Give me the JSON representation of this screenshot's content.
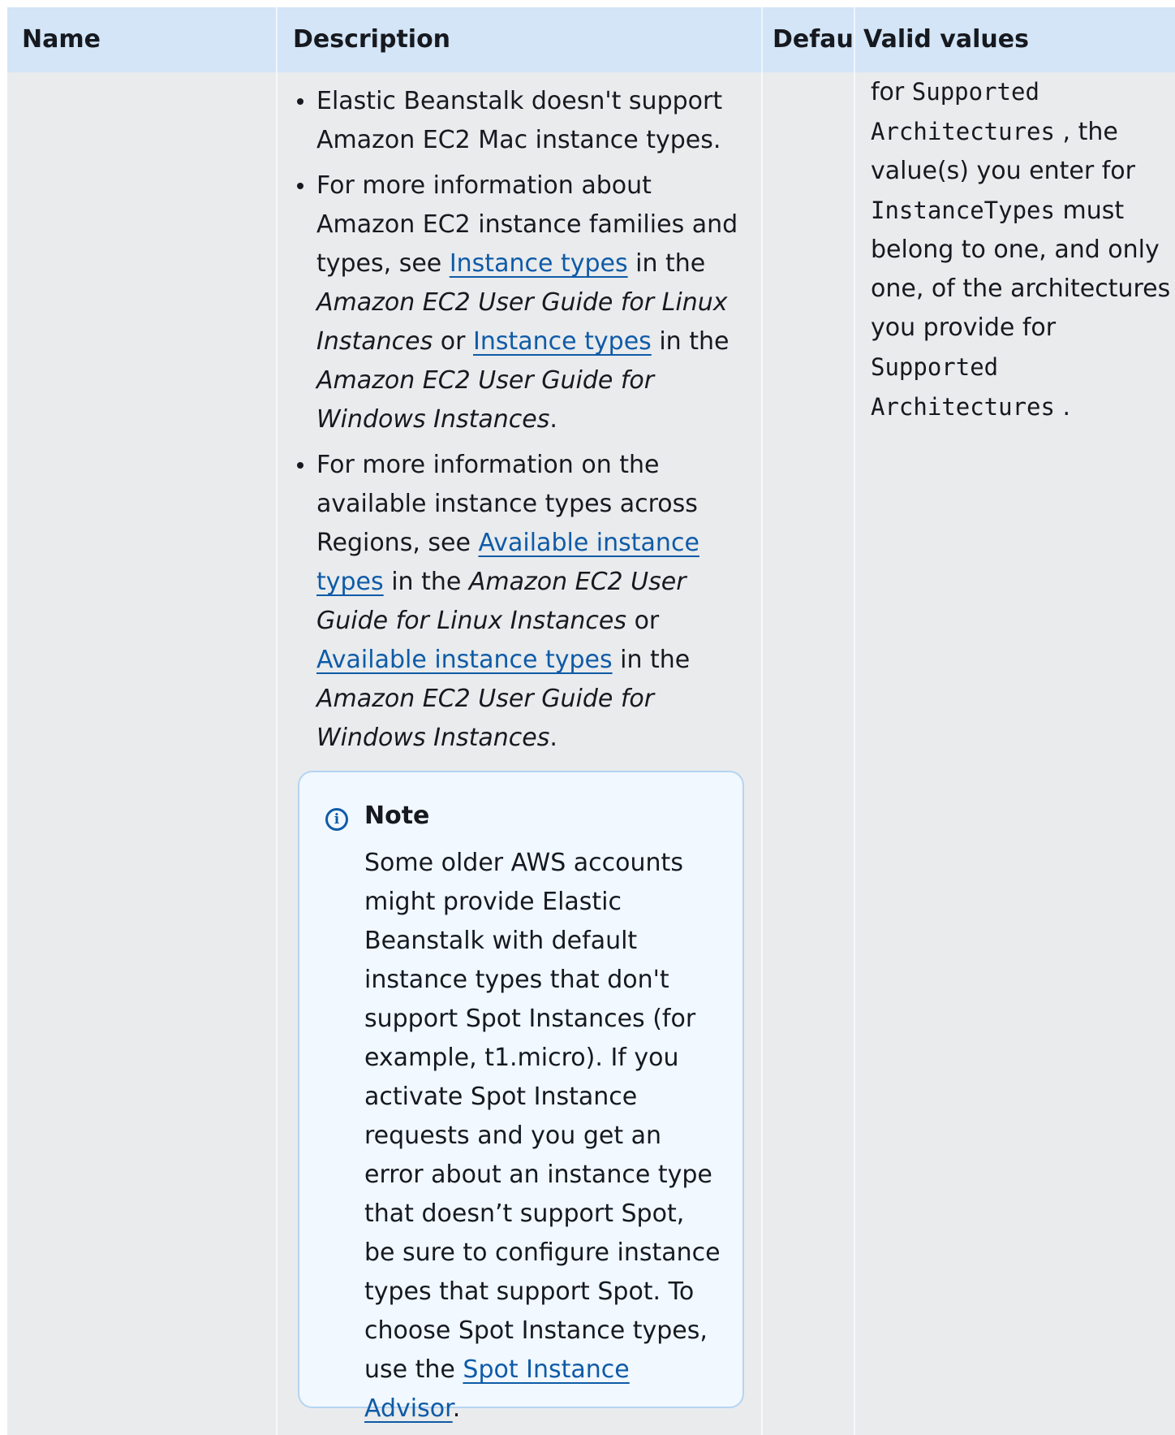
{
  "header": {
    "name": "Name",
    "description": "Description",
    "default": "Default",
    "valid_values": "Valid values"
  },
  "description": {
    "bullet1": {
      "text": "Elastic Beanstalk doesn't support Amazon EC2 Mac instance types."
    },
    "bullet2": {
      "t1": "For more information about Amazon EC2 instance families and types, see ",
      "link1": "Instance types",
      "t2": " in the ",
      "i1": "Amazon EC2 User Guide for Linux Instances",
      "t3": " or ",
      "link2": "Instance types",
      "t4": " in the ",
      "i2": "Amazon EC2 User Guide for Windows Instances",
      "t5": "."
    },
    "bullet3": {
      "t1": "For more information on the available instance types across Regions, see ",
      "link1": "Available instance types",
      "t2": " in the ",
      "i1": "Amazon EC2 User Guide for Linux Instances",
      "t3": " or ",
      "link2": "Available instance types",
      "t4": " in the ",
      "i2": "Amazon EC2 User Guide for Windows Instances",
      "t5": "."
    }
  },
  "note": {
    "icon": "info-icon",
    "title": "Note",
    "body": "Some older AWS accounts might provide Elastic Beanstalk with default instance types that don't support Spot Instances (for example, t1.micro). If you activate Spot Instance requests and you get an error about an instance type that doesn’t support Spot, be sure to configure instance types that support Spot. To choose Spot Instance types, use the ",
    "link": "Spot Instance Advisor",
    "end": "."
  },
  "valid_values": {
    "t1": "for ",
    "code1": "Supported Architectures",
    "t2": " , the value(s) you enter for ",
    "code2": "InstanceTypes",
    "t3": " must belong to one, and only one, of the architectures you provide for ",
    "code3": "Supported Architectures",
    "t4": " ."
  }
}
